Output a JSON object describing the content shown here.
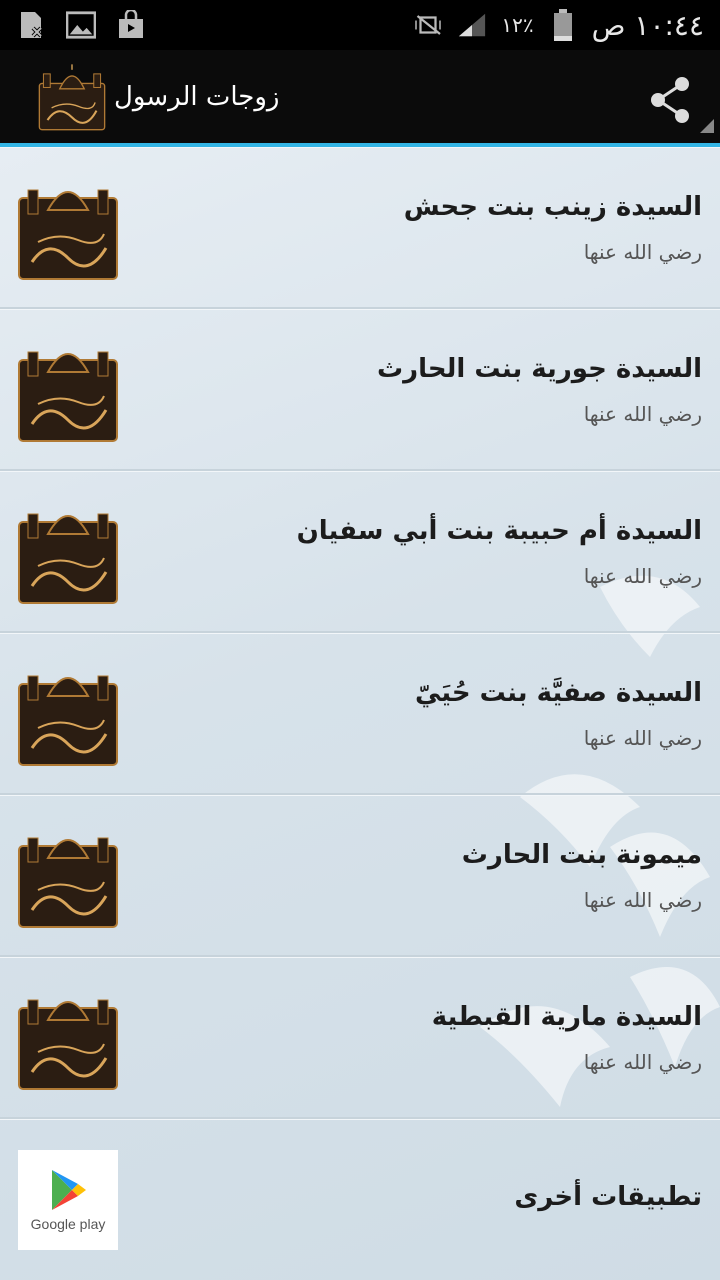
{
  "status_bar": {
    "time": "١٠:٤٤ ص",
    "battery": "١٢٪"
  },
  "app_bar": {
    "title": "زوجات الرسول",
    "logo_text": "زوجات الرسول"
  },
  "items": [
    {
      "title": "السيدة زينب بنت جحش",
      "subtitle": "رضي الله عنها"
    },
    {
      "title": "السيدة جورية بنت الحارث",
      "subtitle": "رضي الله عنها"
    },
    {
      "title": "السيدة أم حبيبة بنت أبي سفيان",
      "subtitle": "رضي الله عنها"
    },
    {
      "title": "السيدة  صفيَّة بنت حُيَيّ",
      "subtitle": "رضي الله عنها"
    },
    {
      "title": "ميمونة بنت الحارث",
      "subtitle": "رضي الله عنها"
    },
    {
      "title": "السيدة مارية القبطية",
      "subtitle": "رضي الله عنها"
    }
  ],
  "more_apps": {
    "title": "تطبيقات أخرى",
    "store_label": "Google play"
  },
  "colors": {
    "accent": "#33b5e5",
    "logo_bg": "#2b1d12",
    "logo_gold": "#d9a55a"
  }
}
